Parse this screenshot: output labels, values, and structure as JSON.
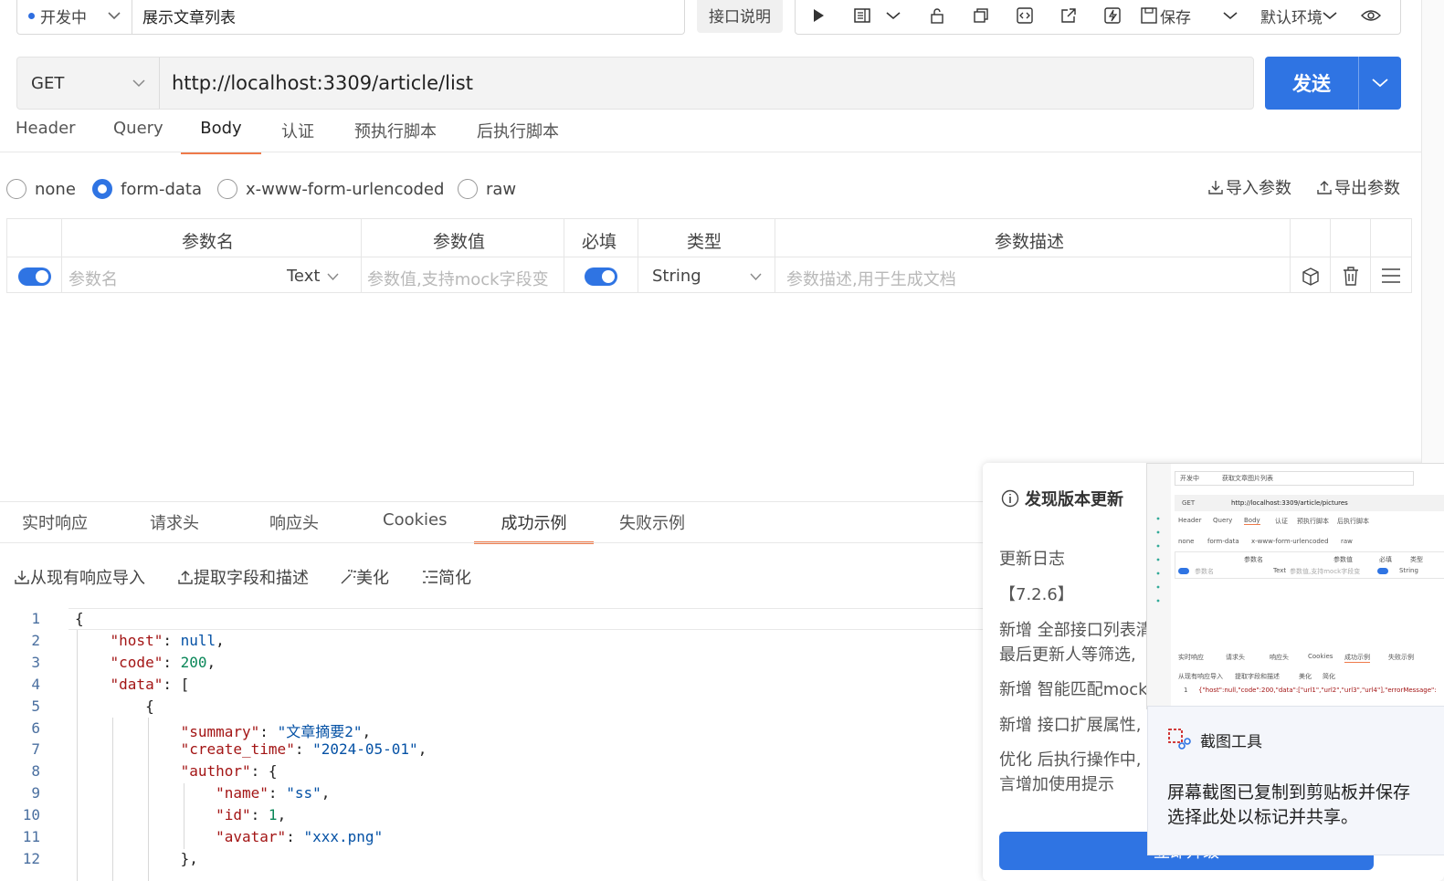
{
  "topbar": {
    "status": "开发中",
    "api_title": "展示文章列表",
    "doc_button": "接口说明",
    "save_label": "保存",
    "env_label": "默认环境"
  },
  "request": {
    "method": "GET",
    "url": "http://localhost:3309/article/list",
    "send_label": "发送"
  },
  "req_tabs": [
    "Header",
    "Query",
    "Body",
    "认证",
    "预执行脚本",
    "后执行脚本"
  ],
  "body_modes": [
    "none",
    "form-data",
    "x-www-form-urlencoded",
    "raw"
  ],
  "body_mode_selected": "form-data",
  "import_params": "导入参数",
  "export_params": "导出参数",
  "params_table": {
    "headers": [
      "参数名",
      "参数值",
      "必填",
      "类型",
      "参数描述"
    ],
    "row": {
      "name_placeholder": "参数名",
      "field_type": "Text",
      "value_placeholder": "参数值,支持mock字段变",
      "type": "String",
      "desc_placeholder": "参数描述,用于生成文档"
    }
  },
  "resp_tabs": [
    "实时响应",
    "请求头",
    "响应头",
    "Cookies",
    "成功示例",
    "失败示例"
  ],
  "resp_tools": [
    "从现有响应导入",
    "提取字段和描述",
    "美化",
    "简化"
  ],
  "code_lines": [
    "{",
    "    \"host\": null,",
    "    \"code\": 200,",
    "    \"data\": [",
    "        {",
    "            \"summary\": \"文章摘要2\",",
    "            \"create_time\": \"2024-05-01\",",
    "            \"author\": {",
    "                \"name\": \"ss\",",
    "                \"id\": 1,",
    "                \"avatar\": \"xxx.png\"",
    "            },"
  ],
  "update_popup": {
    "title": "发现版本更新",
    "changelog_label": "更新日志",
    "version": "【7.2.6】",
    "items": [
      "新增 全部接口列表清",
      "最后更新人等筛选,",
      "新增 智能匹配mock",
      "新增 接口扩展属性,",
      "优化 后执行操作中,",
      "言增加使用提示"
    ],
    "upgrade_label": "立即升级"
  },
  "thumbnail": {
    "status": "开发中",
    "title": "获取文章图片列表",
    "url": "http://localhost:3309/article/pictures",
    "tabs": [
      "Header",
      "Query",
      "Body",
      "认证",
      "预执行脚本",
      "后执行脚本"
    ],
    "modes": [
      "none",
      "form-data",
      "x-www-form-urlencoded",
      "raw"
    ],
    "headers": [
      "参数名",
      "参数值",
      "必填",
      "类型"
    ],
    "row": [
      "参数名",
      "Text",
      "参数值,支持mock字段变",
      "String"
    ],
    "resp_tabs": [
      "实时响应",
      "请求头",
      "响应头",
      "Cookies",
      "成功示例",
      "失败示例"
    ],
    "resp_tools": [
      "从现有响应导入",
      "提取字段和描述",
      "美化",
      "简化"
    ],
    "code": "{\"host\":null,\"code\":200,\"data\":[\"url1\",\"url2\",\"url3\",\"url4\"],\"errorMessage\":"
  },
  "snip_toast": {
    "title": "截图工具",
    "line1": "屏幕截图已复制到剪贴板并保存",
    "line2": "选择此处以标记并共享。"
  }
}
